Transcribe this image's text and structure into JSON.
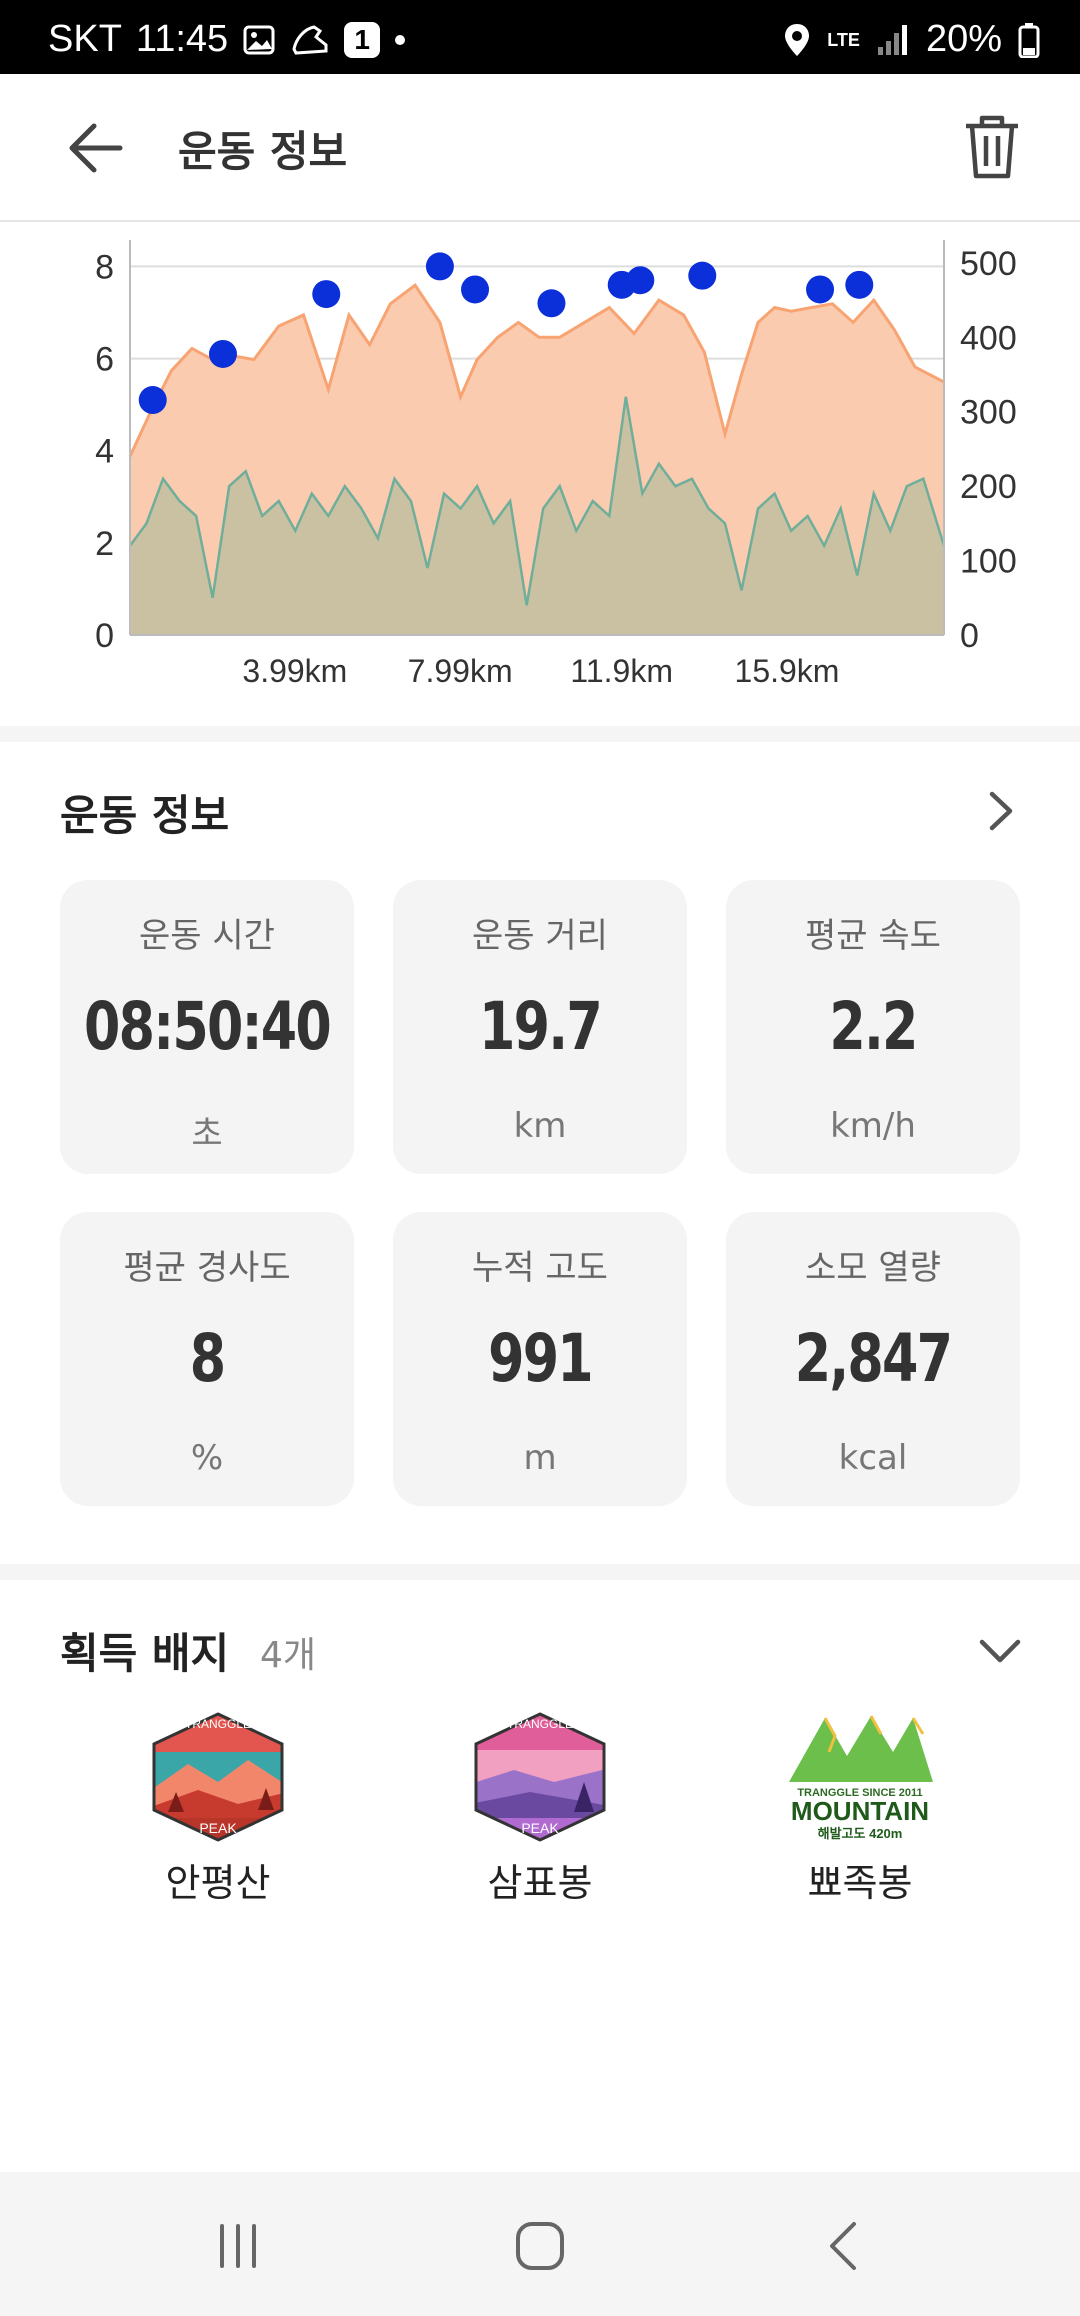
{
  "status_bar": {
    "carrier": "SKT",
    "time": "11:45",
    "notification_count": "1",
    "network": "LTE",
    "battery": "20%"
  },
  "header": {
    "title": "운동 정보"
  },
  "chart_data": {
    "type": "area",
    "x_tick_labels": [
      "3.99km",
      "7.99km",
      "11.9km",
      "15.9km"
    ],
    "y_left_ticks": [
      "0",
      "2",
      "4",
      "6",
      "8"
    ],
    "y_right_ticks": [
      "0",
      "100",
      "200",
      "300",
      "400",
      "500"
    ],
    "y_left_range": [
      0,
      8.4
    ],
    "y_right_range": [
      0,
      520
    ],
    "x_range": [
      0,
      19.7
    ],
    "grid": true,
    "series": [
      {
        "color": "#f7a472",
        "x": [
          0,
          0.5,
          1.0,
          1.5,
          2.0,
          2.5,
          3.0,
          3.6,
          4.2,
          4.8,
          5.3,
          5.8,
          6.3,
          6.9,
          7.5,
          8.0,
          8.4,
          8.9,
          9.4,
          9.9,
          10.4,
          11.0,
          11.6,
          12.2,
          12.8,
          13.4,
          13.9,
          14.4,
          14.8,
          15.2,
          15.6,
          16.0,
          16.5,
          17.0,
          17.5,
          18.0,
          18.5,
          19.0,
          19.7
        ],
        "y": [
          240,
          300,
          355,
          385,
          370,
          375,
          370,
          415,
          430,
          330,
          430,
          390,
          445,
          470,
          420,
          320,
          370,
          400,
          420,
          400,
          400,
          420,
          440,
          405,
          450,
          430,
          380,
          270,
          350,
          420,
          440,
          435,
          440,
          445,
          420,
          450,
          410,
          360,
          340
        ],
        "fill_color": "#fbcbb0"
      },
      {
        "color": "#6fae9a",
        "note": "",
        "x": [
          0,
          0.4,
          0.8,
          1.2,
          1.6,
          2.0,
          2.4,
          2.8,
          3.2,
          3.6,
          4.0,
          4.4,
          4.8,
          5.2,
          5.6,
          6.0,
          6.4,
          6.8,
          7.2,
          7.6,
          8.0,
          8.4,
          8.8,
          9.2,
          9.6,
          10.0,
          10.4,
          10.8,
          11.2,
          11.6,
          12.0,
          12.4,
          12.8,
          13.2,
          13.6,
          14.0,
          14.4,
          14.8,
          15.2,
          15.6,
          16.0,
          16.4,
          16.8,
          17.2,
          17.6,
          18.0,
          18.4,
          18.8,
          19.2,
          19.7
        ],
        "y": [
          120,
          150,
          210,
          180,
          160,
          50,
          200,
          220,
          160,
          180,
          140,
          190,
          160,
          200,
          170,
          130,
          210,
          180,
          90,
          190,
          170,
          200,
          150,
          180,
          40,
          170,
          200,
          140,
          180,
          160,
          320,
          190,
          230,
          200,
          210,
          170,
          150,
          60,
          170,
          190,
          140,
          160,
          120,
          170,
          80,
          190,
          140,
          200,
          210,
          120
        ]
      }
    ],
    "markers": {
      "color": "#0b2fd8",
      "x": [
        0.55,
        2.25,
        4.75,
        7.5,
        8.35,
        10.2,
        11.9,
        12.35,
        13.85,
        16.7,
        17.65
      ],
      "y": [
        5.1,
        6.1,
        7.4,
        8.0,
        7.5,
        7.2,
        7.6,
        7.7,
        7.8,
        7.5,
        7.6
      ]
    }
  },
  "info": {
    "title": "운동 정보",
    "cards": [
      {
        "label": "운동 시간",
        "value": "08:50:40",
        "unit": "초"
      },
      {
        "label": "운동 거리",
        "value": "19.7",
        "unit": "km"
      },
      {
        "label": "평균 속도",
        "value": "2.2",
        "unit": "km/h"
      },
      {
        "label": "평균 경사도",
        "value": "8",
        "unit": "%"
      },
      {
        "label": "누적 고도",
        "value": "991",
        "unit": "m"
      },
      {
        "label": "소모 열량",
        "value": "2,847",
        "unit": "kcal"
      }
    ]
  },
  "badges": {
    "title": "획득 배지",
    "count": "4개",
    "items": [
      {
        "name": "안평산",
        "brand": "TRANGGLE",
        "tag": "PEAK",
        "style": "sunset"
      },
      {
        "name": "삼표봉",
        "brand": "TRANGGLE",
        "tag": "PEAK",
        "style": "violet"
      },
      {
        "name": "뾰족봉",
        "line1": "TRANGGLE SINCE 2011",
        "line2": "MOUNTAIN",
        "line3": "해발고도 420m"
      }
    ]
  }
}
